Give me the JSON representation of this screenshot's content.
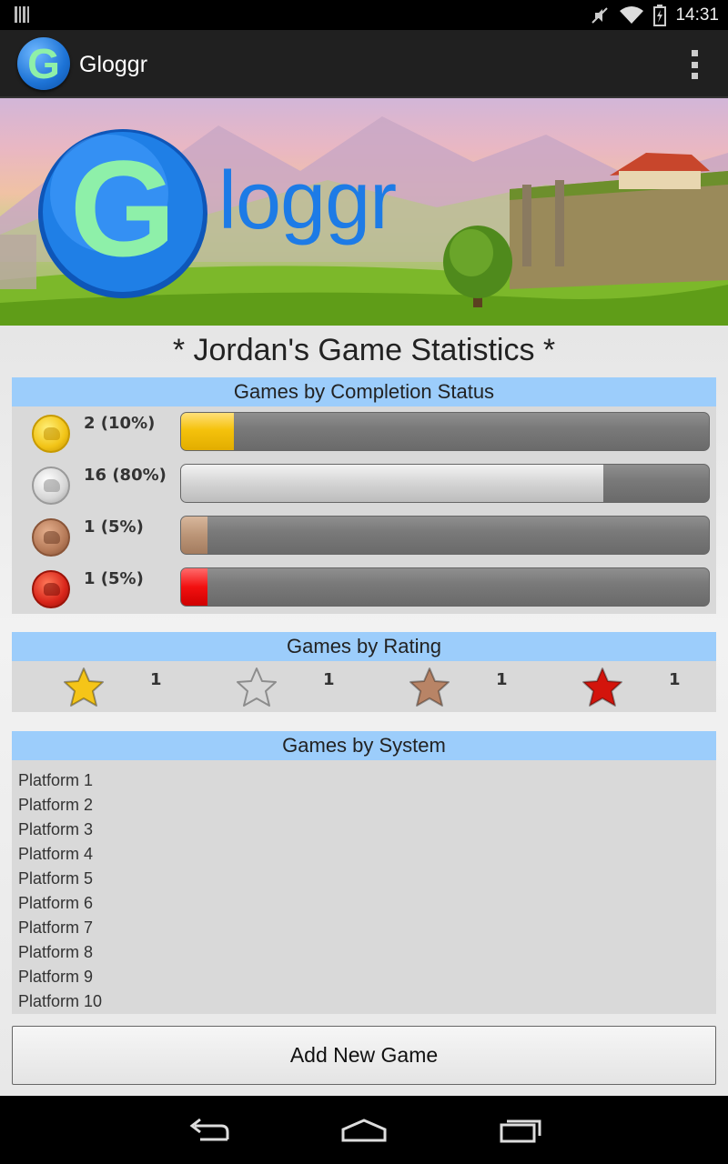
{
  "status_bar": {
    "time": "14:31",
    "icons": [
      "signal-bars-icon",
      "mute-icon",
      "wifi-icon",
      "battery-icon"
    ]
  },
  "action_bar": {
    "app_icon_letter": "G",
    "app_title": "Gloggr",
    "overflow_icon": "overflow-menu-icon"
  },
  "banner": {
    "logo_letter": "G",
    "logo_text": "loggr"
  },
  "page": {
    "title": "* Jordan's Game Statistics *"
  },
  "completion_section": {
    "title": "Games by Completion Status",
    "rows": [
      {
        "medal": "gold",
        "label": "2 (10%)",
        "fraction": 0.1,
        "color": "#f5c20c"
      },
      {
        "medal": "silver",
        "label": "16 (80%)",
        "fraction": 0.8,
        "color": "#d4d4d4"
      },
      {
        "medal": "bronze",
        "label": "1 (5%)",
        "fraction": 0.05,
        "color": "#bb9577"
      },
      {
        "medal": "red",
        "label": "1 (5%)",
        "fraction": 0.05,
        "color": "#f21010"
      }
    ]
  },
  "rating_section": {
    "title": "Games by Rating",
    "items": [
      {
        "star": "gold",
        "count": "1",
        "color": "#f5c518"
      },
      {
        "star": "silver",
        "count": "1",
        "color": "#d8d8d8"
      },
      {
        "star": "bronze",
        "count": "1",
        "color": "#b88466"
      },
      {
        "star": "red",
        "count": "1",
        "color": "#d3140c"
      }
    ]
  },
  "system_section": {
    "title": "Games by System",
    "platforms": [
      "Platform 1",
      "Platform 2",
      "Platform 3",
      "Platform 4",
      "Platform 5",
      "Platform 6",
      "Platform 7",
      "Platform 8",
      "Platform 9",
      "Platform 10"
    ]
  },
  "add_button": {
    "label": "Add New Game"
  },
  "nav_bar": {
    "buttons": [
      "back-icon",
      "home-icon",
      "recent-apps-icon"
    ]
  }
}
